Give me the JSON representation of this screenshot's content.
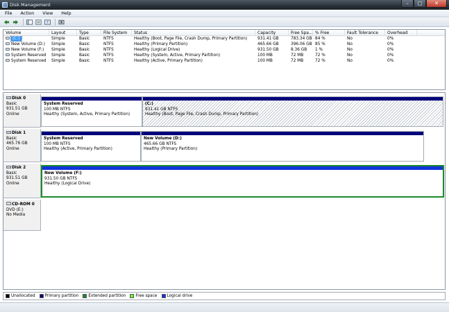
{
  "window": {
    "title": "Disk Management"
  },
  "menu": [
    "File",
    "Action",
    "View",
    "Help"
  ],
  "toolbar": {
    "buttons": [
      "back-icon",
      "forward-icon",
      "show-hide-tree-icon",
      "properties-icon",
      "help-icon",
      "rescan-disks-icon"
    ]
  },
  "volumes": {
    "headers": [
      "Volume",
      "Layout",
      "Type",
      "File System",
      "Status",
      "Capacity",
      "Free Spa...",
      "% Free",
      "Fault Tolerance",
      "Overhead"
    ],
    "rows": [
      [
        "(C:)",
        "Simple",
        "Basic",
        "NTFS",
        "Healthy (Boot, Page File, Crash Dump, Primary Partition)",
        "931.41 GB",
        "783.34 GB",
        "84 %",
        "No",
        "0%"
      ],
      [
        "New Volume (D:)",
        "Simple",
        "Basic",
        "NTFS",
        "Healthy (Primary Partition)",
        "465.66 GB",
        "396.06 GB",
        "85 %",
        "No",
        "0%"
      ],
      [
        "New Volume (F:)",
        "Simple",
        "Basic",
        "NTFS",
        "Healthy (Logical Drive)",
        "931.50 GB",
        "8.36 GB",
        "1 %",
        "No",
        "0%"
      ],
      [
        "System Reserved",
        "Simple",
        "Basic",
        "NTFS",
        "Healthy (System, Active, Primary Partition)",
        "100 MB",
        "72 MB",
        "72 %",
        "No",
        "0%"
      ],
      [
        "System Reserved",
        "Simple",
        "Basic",
        "NTFS",
        "Healthy (Active, Primary Partition)",
        "100 MB",
        "72 MB",
        "72 %",
        "No",
        "0%"
      ]
    ]
  },
  "disks": [
    {
      "name": "Disk 0",
      "type": "Basic",
      "size": "931.51 GB",
      "status": "Online",
      "partitions": [
        {
          "name": "System Reserved",
          "size": "100 MB NTFS",
          "status": "Healthy (System, Active, Primary Partition)"
        },
        {
          "name": "(C:)",
          "size": "931.41 GB NTFS",
          "status": "Healthy (Boot, Page File, Crash Dump, Primary Partition)"
        }
      ]
    },
    {
      "name": "Disk 1",
      "type": "Basic",
      "size": "465.76 GB",
      "status": "Online",
      "partitions": [
        {
          "name": "System Reserved",
          "size": "100 MB NTFS",
          "status": "Healthy (Active, Primary Partition)"
        },
        {
          "name": "New Volume  (D:)",
          "size": "465.66 GB NTFS",
          "status": "Healthy (Primary Partition)"
        }
      ]
    },
    {
      "name": "Disk 2",
      "type": "Basic",
      "size": "931.51 GB",
      "status": "Online",
      "partitions": [
        {
          "name": "New Volume  (F:)",
          "size": "931.50 GB NTFS",
          "status": "Healthy (Logical Drive)"
        }
      ]
    },
    {
      "name": "CD-ROM 0",
      "type": "DVD (E:)",
      "size": "",
      "status": "No Media",
      "partitions": []
    }
  ],
  "legend": [
    {
      "label": "Unallocated",
      "color": "#000000"
    },
    {
      "label": "Primary partition",
      "color": "#00007b"
    },
    {
      "label": "Extended partition",
      "color": "#1a8a2a"
    },
    {
      "label": "Free space",
      "color": "#66ff33"
    },
    {
      "label": "Logical drive",
      "color": "#1133dd"
    }
  ]
}
